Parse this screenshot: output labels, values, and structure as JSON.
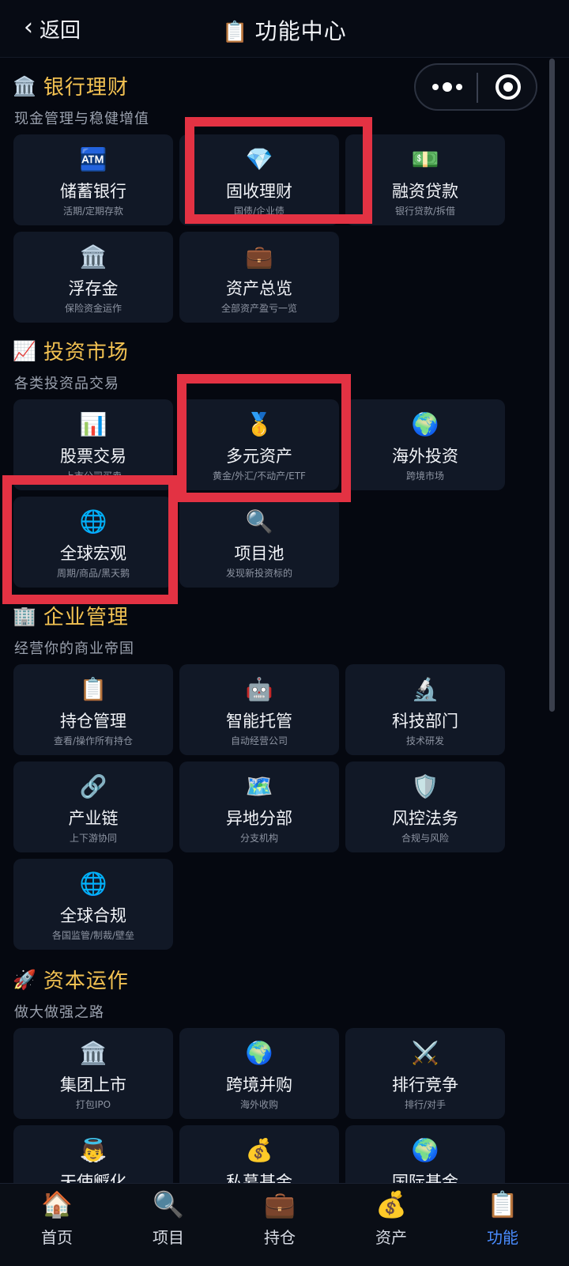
{
  "header": {
    "back_label": "返回",
    "back_icon": "‹",
    "title": "功能中心",
    "title_icon": "📋"
  },
  "sections": [
    {
      "title": "银行理财",
      "icon": "🏛️",
      "subtitle": "现金管理与稳健增值",
      "items": [
        {
          "name": "储蓄银行",
          "desc": "活期/定期存款",
          "icon": "🏧"
        },
        {
          "name": "固收理财",
          "desc": "国债/企业债",
          "icon": "💎"
        },
        {
          "name": "融资贷款",
          "desc": "银行贷款/拆借",
          "icon": "💵"
        },
        {
          "name": "浮存金",
          "desc": "保险资金运作",
          "icon": "🏛️"
        },
        {
          "name": "资产总览",
          "desc": "全部资产盈亏一览",
          "icon": "💼"
        }
      ]
    },
    {
      "title": "投资市场",
      "icon": "📈",
      "subtitle": "各类投资品交易",
      "items": [
        {
          "name": "股票交易",
          "desc": "上市公司买卖",
          "icon": "📊"
        },
        {
          "name": "多元资产",
          "desc": "黄金/外汇/不动产/ETF",
          "icon": "🥇"
        },
        {
          "name": "海外投资",
          "desc": "跨境市场",
          "icon": "🌍"
        },
        {
          "name": "全球宏观",
          "desc": "周期/商品/黑天鹅",
          "icon": "🌐"
        },
        {
          "name": "项目池",
          "desc": "发现新投资标的",
          "icon": "🔍"
        }
      ]
    },
    {
      "title": "企业管理",
      "icon": "🏢",
      "subtitle": "经营你的商业帝国",
      "items": [
        {
          "name": "持仓管理",
          "desc": "查看/操作所有持仓",
          "icon": "📋"
        },
        {
          "name": "智能托管",
          "desc": "自动经营公司",
          "icon": "🤖"
        },
        {
          "name": "科技部门",
          "desc": "技术研发",
          "icon": "🔬"
        },
        {
          "name": "产业链",
          "desc": "上下游协同",
          "icon": "🔗"
        },
        {
          "name": "异地分部",
          "desc": "分支机构",
          "icon": "🗺️"
        },
        {
          "name": "风控法务",
          "desc": "合规与风险",
          "icon": "🛡️"
        },
        {
          "name": "全球合规",
          "desc": "各国监管/制裁/壁垒",
          "icon": "🌐"
        }
      ]
    },
    {
      "title": "资本运作",
      "icon": "🚀",
      "subtitle": "做大做强之路",
      "items": [
        {
          "name": "集团上市",
          "desc": "打包IPO",
          "icon": "🏛️"
        },
        {
          "name": "跨境并购",
          "desc": "海外收购",
          "icon": "🌍"
        },
        {
          "name": "排行竞争",
          "desc": "排行/对手",
          "icon": "⚔️"
        },
        {
          "name": "天使孵化",
          "desc": "",
          "icon": "👼"
        },
        {
          "name": "私募基金",
          "desc": "",
          "icon": "💰"
        },
        {
          "name": "国际基金",
          "desc": "",
          "icon": "🌍"
        }
      ]
    }
  ],
  "tabs": [
    {
      "label": "首页",
      "icon": "🏠"
    },
    {
      "label": "项目",
      "icon": "🔍"
    },
    {
      "label": "持仓",
      "icon": "💼"
    },
    {
      "label": "资产",
      "icon": "💰"
    },
    {
      "label": "功能",
      "icon": "📋"
    }
  ],
  "colors": {
    "background": "#050810",
    "card": "#111826",
    "section_title": "#f3c252",
    "highlight": "#e33243",
    "active_tab": "#4a8cff"
  }
}
